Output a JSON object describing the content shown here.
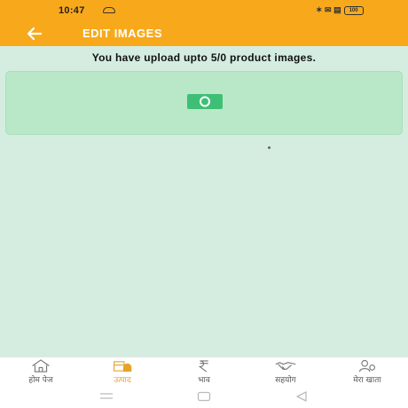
{
  "status_bar": {
    "time": "10:47",
    "right_indicators": "✶ ✉ ▤",
    "battery_label": "100"
  },
  "toolbar": {
    "back_icon": "arrow-left-icon",
    "title": "EDIT IMAGES"
  },
  "upload_info": "You have upload upto 5/0 product images.",
  "image_box": {
    "icon": "camera-icon"
  },
  "bottom_nav": {
    "items": [
      {
        "label": "होम पेज",
        "icon": "home-icon",
        "active": false
      },
      {
        "label": "उत्पाद",
        "icon": "products-icon",
        "active": true
      },
      {
        "label": "भाव",
        "icon": "rupee-icon",
        "active": false
      },
      {
        "label": "सहयोग",
        "icon": "handshake-icon",
        "active": false
      },
      {
        "label": "मेरा खाता",
        "icon": "account-icon",
        "active": false
      }
    ]
  },
  "system_nav": {
    "buttons": [
      "menu-icon",
      "home-square-icon",
      "back-triangle-icon"
    ]
  },
  "colors": {
    "header": "#f8a91b",
    "background": "#d4ede0",
    "image_box": "#b9e8c8",
    "camera": "#3fbf75",
    "active_nav": "#e6a32a"
  }
}
